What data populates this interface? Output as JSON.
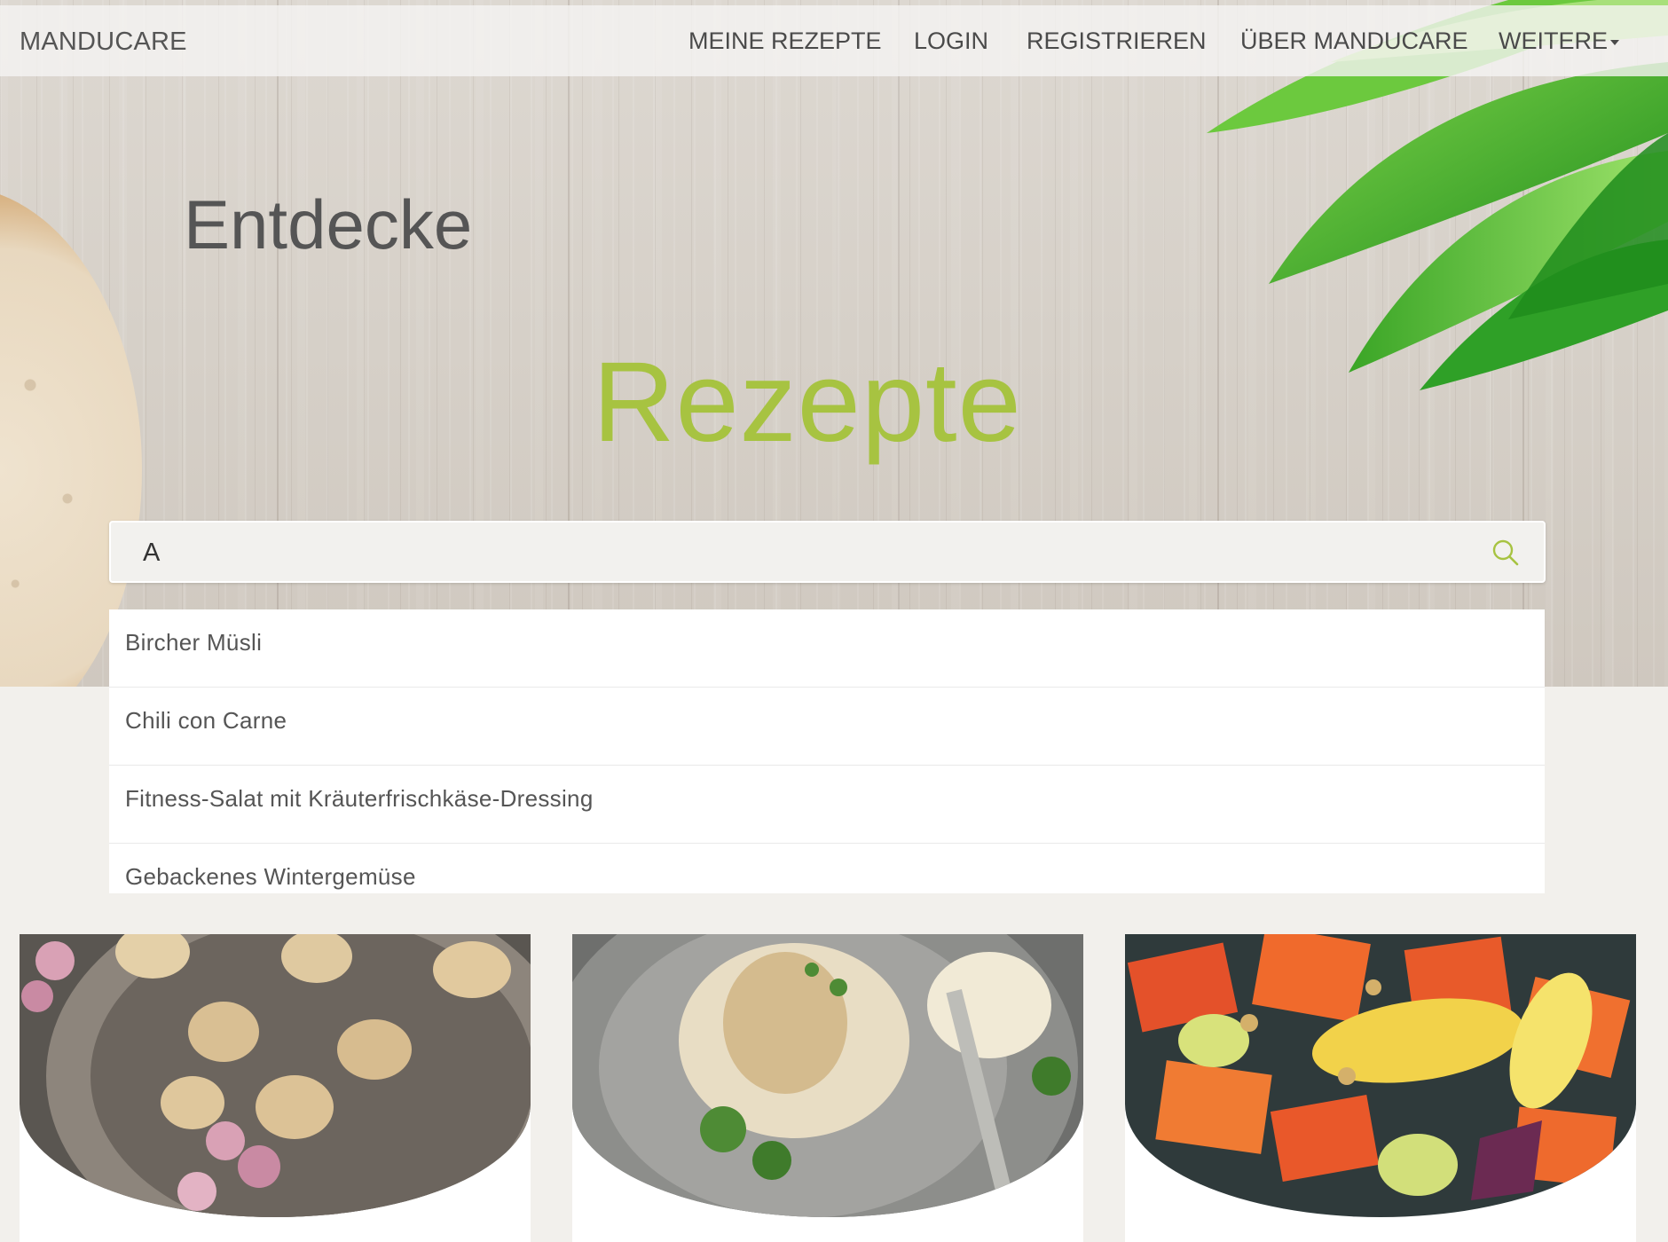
{
  "navbar": {
    "brand": "MANDUCARE",
    "items": [
      {
        "label": "MEINE REZEPTE"
      },
      {
        "label": "LOGIN"
      },
      {
        "label": "REGISTRIEREN"
      },
      {
        "label": "ÜBER MANDUCARE"
      },
      {
        "label": "WEITERE"
      }
    ]
  },
  "hero": {
    "subtitle": "Entdecke",
    "title": "Rezepte"
  },
  "search": {
    "value": "A",
    "icon": "search-icon"
  },
  "suggestions": [
    {
      "label": "Bircher Müsli"
    },
    {
      "label": "Chili con Carne"
    },
    {
      "label": "Fitness-Salat mit Kräuterfrischkäse-Dressing"
    },
    {
      "label": "Gebackenes Wintergemüse"
    }
  ],
  "colors": {
    "accent": "#a7c341",
    "text": "#555555",
    "background": "#f2f0ec"
  }
}
